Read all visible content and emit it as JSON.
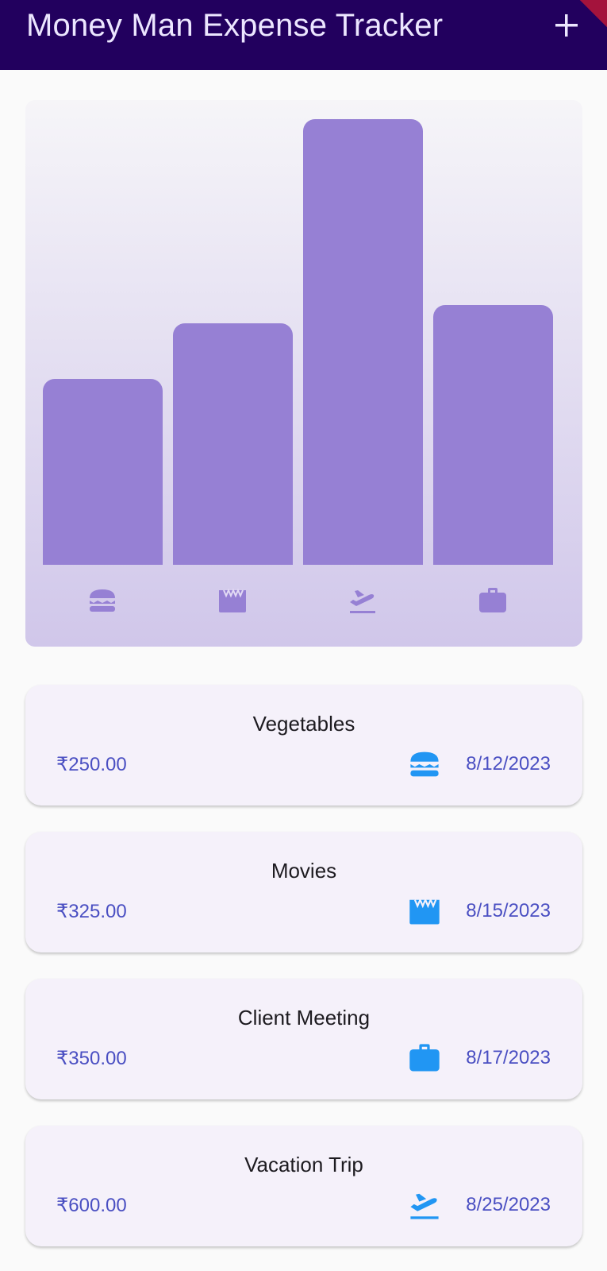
{
  "app": {
    "title": "Money Man Expense Tracker"
  },
  "colors": {
    "appbar": "#22005e",
    "bar": "#9680d4",
    "chart_icon": "#9680d4",
    "amount_text": "#4a4fc2",
    "list_icon": "#2196f3"
  },
  "chart_data": {
    "type": "bar",
    "categories": [
      "food",
      "leisure",
      "travel",
      "work"
    ],
    "category_icons": [
      "burger-icon",
      "clapperboard-icon",
      "flight-takeoff-icon",
      "briefcase-icon"
    ],
    "values": [
      250,
      325,
      600,
      350
    ],
    "ylim": [
      0,
      600
    ]
  },
  "expenses": [
    {
      "title": "Vegetables",
      "amount": "₹250.00",
      "date": "8/12/2023",
      "icon": "burger-icon"
    },
    {
      "title": "Movies",
      "amount": "₹325.00",
      "date": "8/15/2023",
      "icon": "clapperboard-icon"
    },
    {
      "title": "Client Meeting",
      "amount": "₹350.00",
      "date": "8/17/2023",
      "icon": "briefcase-icon"
    },
    {
      "title": "Vacation Trip",
      "amount": "₹600.00",
      "date": "8/25/2023",
      "icon": "flight-takeoff-icon"
    }
  ]
}
